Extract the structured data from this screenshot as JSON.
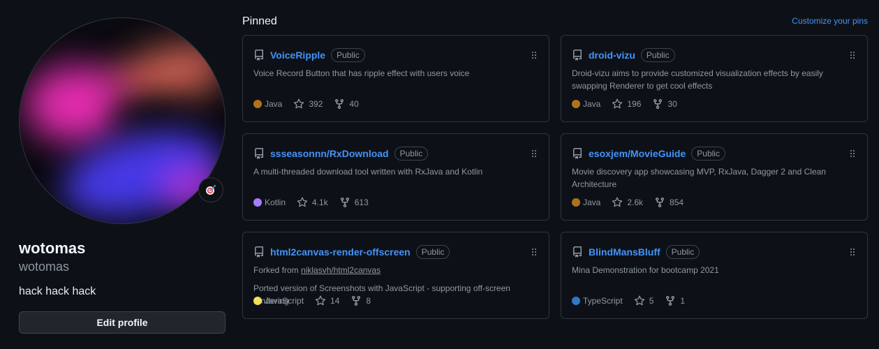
{
  "profile": {
    "display_name": "wotomas",
    "username": "wotomas",
    "bio": "hack hack hack",
    "edit_button_label": "Edit profile",
    "status_icon": "dart-icon"
  },
  "pinned": {
    "title": "Pinned",
    "customize_label": "Customize your pins",
    "repos": [
      {
        "name": "VoiceRipple",
        "visibility": "Public",
        "forked_from_prefix": "",
        "forked_from": "",
        "description": "Voice Record Button that has ripple effect with users voice",
        "language": "Java",
        "language_color": "#b07219",
        "stars": "392",
        "forks": "40"
      },
      {
        "name": "droid-vizu",
        "visibility": "Public",
        "forked_from_prefix": "",
        "forked_from": "",
        "description": "Droid-vizu aims to provide customized visualization effects by easily swapping Renderer to get cool effects",
        "language": "Java",
        "language_color": "#b07219",
        "stars": "196",
        "forks": "30"
      },
      {
        "name": "ssseasonnn/RxDownload",
        "visibility": "Public",
        "forked_from_prefix": "",
        "forked_from": "",
        "description": "A multi-threaded download tool written with RxJava and Kotlin",
        "language": "Kotlin",
        "language_color": "#a97bff",
        "stars": "4.1k",
        "forks": "613"
      },
      {
        "name": "esoxjem/MovieGuide",
        "visibility": "Public",
        "forked_from_prefix": "",
        "forked_from": "",
        "description": "Movie discovery app showcasing MVP, RxJava, Dagger 2 and Clean Architecture",
        "language": "Java",
        "language_color": "#b07219",
        "stars": "2.6k",
        "forks": "854"
      },
      {
        "name": "html2canvas-render-offscreen",
        "visibility": "Public",
        "forked_from_prefix": "Forked from",
        "forked_from": "niklasvh/html2canvas",
        "description": "Ported version of Screenshots with JavaScript - supporting off-screen rendering",
        "language": "JavaScript",
        "language_color": "#f1e05a",
        "stars": "14",
        "forks": "8"
      },
      {
        "name": "BlindMansBluff",
        "visibility": "Public",
        "forked_from_prefix": "",
        "forked_from": "",
        "description": "Mina Demonstration for bootcamp 2021",
        "language": "TypeScript",
        "language_color": "#3178c6",
        "stars": "5",
        "forks": "1"
      }
    ]
  }
}
